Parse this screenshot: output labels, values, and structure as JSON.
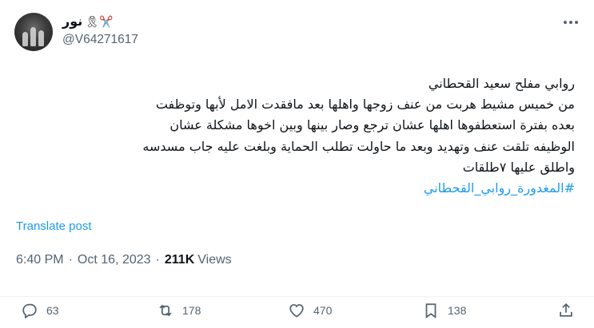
{
  "author": {
    "display_name": "نور",
    "name_emojis": "🎗✂️",
    "handle": "@V64271617"
  },
  "tweet": {
    "lines": [
      "روابي مفلح سعيد القحطاني",
      "من خميس مشيط هربت من عنف زوجها واهلها بعد مافقدت الامل لأبها وتوظفت",
      "بعده بفترة استعطفوها اهلها عشان ترجع وصار بينها وبين اخوها مشكلة عشان",
      "الوظيفه تلقت عنف وتهديد وبعد ما حاولت تطلب الحماية وبلغت عليه جاب مسدسه",
      "واطلق عليها ٧طلقات"
    ],
    "hashtag": "#المغدورة_روابي_القحطاني",
    "translate_label": "Translate post",
    "time": "6:40 PM",
    "date": "Oct 16, 2023",
    "views_count": "211K",
    "views_label": "Views"
  },
  "actions": {
    "replies": "63",
    "reposts": "178",
    "likes": "470",
    "bookmarks": "138"
  },
  "colors": {
    "link": "#1d9bf0",
    "secondary_text": "#536471",
    "primary_text": "#0f1419"
  }
}
